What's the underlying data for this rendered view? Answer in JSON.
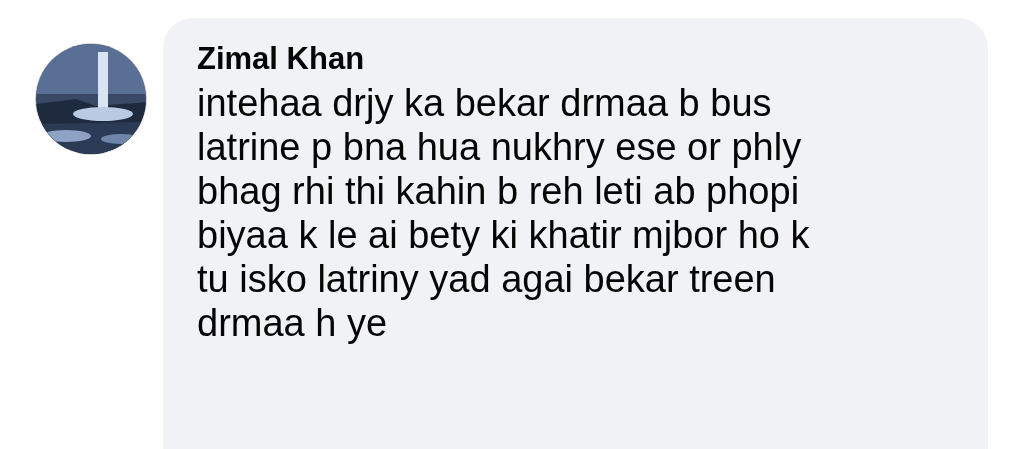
{
  "comment": {
    "author": "Zimal Khan",
    "text_lines": [
      "intehaa drjy ka bekar drmaa b bus",
      "latrine p bna hua nukhry ese or phly",
      "bhag rhi thi kahin b reh leti ab phopi",
      "biyaa k le ai bety ki khatir mjbor ho k",
      "tu isko latriny yad agai bekar treen",
      "drmaa h ye"
    ]
  }
}
